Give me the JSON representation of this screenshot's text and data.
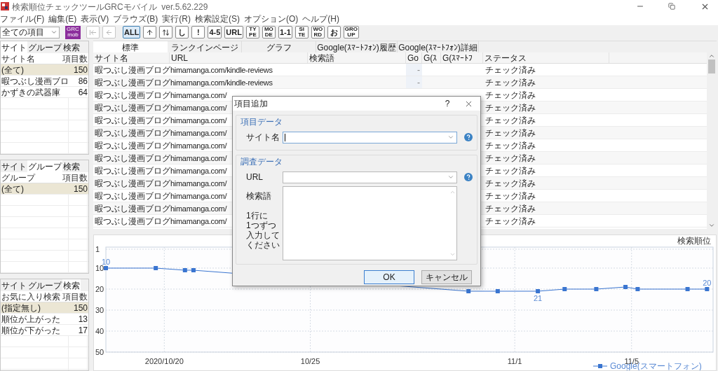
{
  "window": {
    "title": "検索順位チェックツールGRCモバイル  ver.5.62.229"
  },
  "menu": [
    "ファイル(F)",
    "編集(E)",
    "表示(V)",
    "ブラウズ(B)",
    "実行(R)",
    "検索設定(S)",
    "オプション(O)",
    "ヘルプ(H)"
  ],
  "toolbar": {
    "filter": "全ての項目",
    "items": [
      {
        "kind": "logo",
        "lines": [
          "GRC",
          "mob"
        ],
        "selected": false,
        "disabled": false
      },
      {
        "kind": "first",
        "selected": false,
        "disabled": true
      },
      {
        "kind": "back",
        "selected": false,
        "disabled": true
      },
      {
        "kind": "text",
        "lines": [
          "ALL"
        ],
        "selected": true,
        "disabled": false
      },
      {
        "kind": "up",
        "selected": false,
        "disabled": false
      },
      {
        "kind": "updown",
        "selected": false,
        "disabled": false
      },
      {
        "kind": "text",
        "lines": [
          "し"
        ],
        "selected": false,
        "disabled": false
      },
      {
        "kind": "text",
        "lines": [
          "!"
        ],
        "selected": false,
        "disabled": false
      },
      {
        "kind": "text",
        "lines": [
          "4-5"
        ],
        "selected": false,
        "disabled": false
      },
      {
        "kind": "text",
        "lines": [
          "URL"
        ],
        "selected": false,
        "disabled": false
      },
      {
        "kind": "text",
        "lines": [
          "TY",
          "PE"
        ],
        "selected": false,
        "disabled": false
      },
      {
        "kind": "text",
        "lines": [
          "MO",
          "DE"
        ],
        "selected": false,
        "disabled": false
      },
      {
        "kind": "text",
        "lines": [
          "1-1"
        ],
        "selected": false,
        "disabled": false
      },
      {
        "kind": "text",
        "lines": [
          "SI",
          "TE"
        ],
        "selected": false,
        "disabled": false
      },
      {
        "kind": "text",
        "lines": [
          "WO",
          "RD"
        ],
        "selected": false,
        "disabled": false
      },
      {
        "kind": "text",
        "lines": [
          "お"
        ],
        "selected": false,
        "disabled": false
      },
      {
        "kind": "text",
        "lines": [
          "GRO",
          "UP"
        ],
        "selected": false,
        "disabled": false
      }
    ]
  },
  "side_panels": [
    {
      "tabs": [
        {
          "label": "サイト",
          "selected": true
        },
        {
          "label": "グループ",
          "selected": false
        },
        {
          "label": "検索",
          "selected": false
        }
      ],
      "columns": [
        "サイト名",
        "項目数"
      ],
      "rows": [
        {
          "name": "(全て)",
          "count": "150",
          "selected": true
        },
        {
          "name": "暇つぶし漫画ブロ",
          "count": "86",
          "selected": false
        },
        {
          "name": "かずきの武器庫",
          "count": "64",
          "selected": false
        }
      ]
    },
    {
      "tabs": [
        {
          "label": "サイト",
          "selected": false
        },
        {
          "label": "グループ",
          "selected": true
        },
        {
          "label": "検索",
          "selected": false
        }
      ],
      "columns": [
        "グループ",
        "項目数"
      ],
      "rows": [
        {
          "name": "(全て)",
          "count": "150",
          "selected": true
        }
      ]
    },
    {
      "tabs": [
        {
          "label": "サイト",
          "selected": false
        },
        {
          "label": "グループ",
          "selected": false
        },
        {
          "label": "検索",
          "selected": true
        }
      ],
      "columns": [
        "お気に入り検索",
        "項目数"
      ],
      "rows": [
        {
          "name": "(指定無し)",
          "count": "150",
          "selected": true
        },
        {
          "name": "順位が上がった",
          "count": "13",
          "selected": false
        },
        {
          "name": "順位が下がった",
          "count": "17",
          "selected": false
        }
      ]
    }
  ],
  "main_tabs": [
    {
      "label": "標準",
      "selected": true
    },
    {
      "label": "ランクインページ",
      "selected": false
    },
    {
      "label": "グラフ",
      "selected": false
    },
    {
      "label": "Google(ｽﾏｰﾄﾌｫﾝ)履歴",
      "selected": false
    },
    {
      "label": "Google(ｽﾏｰﾄﾌｫﾝ)詳細",
      "selected": false
    }
  ],
  "table": {
    "columns": [
      "サイト名",
      "URL",
      "検索語",
      "Go",
      "G(ｽ",
      "G(ｽﾏｰﾄﾌ",
      "ステータス"
    ],
    "rows": [
      {
        "site": "暇つぶし漫画ブログ",
        "url": "himamanga.com/kindle-reviews",
        "go": "-",
        "status": "チェック済み"
      },
      {
        "site": "暇つぶし漫画ブログ",
        "url": "himamanga.com/kindle-reviews",
        "go": "-",
        "status": "チェック済み"
      },
      {
        "site": "暇つぶし漫画ブログ",
        "url": "himamanga.com/",
        "status": "チェック済み"
      },
      {
        "site": "暇つぶし漫画ブログ",
        "url": "himamanga.com/",
        "status": "チェック済み"
      },
      {
        "site": "暇つぶし漫画ブログ",
        "url": "himamanga.com/",
        "status": "チェック済み"
      },
      {
        "site": "暇つぶし漫画ブログ",
        "url": "himamanga.com/",
        "status": "チェック済み"
      },
      {
        "site": "暇つぶし漫画ブログ",
        "url": "himamanga.com/",
        "status": "チェック済み"
      },
      {
        "site": "暇つぶし漫画ブログ",
        "url": "himamanga.com/",
        "status": "チェック済み"
      },
      {
        "site": "暇つぶし漫画ブログ",
        "url": "himamanga.com/",
        "status": "チェック済み"
      },
      {
        "site": "暇つぶし漫画ブログ",
        "url": "himamanga.com/",
        "status": "チェック済み"
      },
      {
        "site": "暇つぶし漫画ブログ",
        "url": "himamanga.com/",
        "status": "チェック済み"
      },
      {
        "site": "暇つぶし漫画ブログ",
        "url": "himamanga.com/",
        "status": "チェック済み"
      },
      {
        "site": "暇つぶし漫画ブログ",
        "url": "himamanga.com/",
        "status": "チェック済み"
      }
    ]
  },
  "chart": {
    "chart_data": {
      "type": "line",
      "title": "検索順位",
      "x": [
        "2020-10-18",
        "2020-10-19T17:00",
        "2020-10-20T17:00",
        "2020-10-21",
        "2020-10-30T10:00",
        "2020-10-31T10:00",
        "2020-11-01T19:00",
        "2020-11-02T17:00",
        "2020-11-03T19:00",
        "2020-11-04T19:00",
        "2020-11-05T05:00",
        "2020-11-06T22:00",
        "2020-11-07T14:00"
      ],
      "grid": true,
      "series": [
        {
          "name": "Google(スマートフォン)",
          "color": "#3a75d0",
          "marker": "square",
          "values": [
            10,
            10,
            11,
            11,
            21,
            21,
            21,
            20,
            20,
            19,
            20,
            20,
            20
          ]
        }
      ],
      "xlim": [
        "2020-10-18",
        "2020-11-07T19:00"
      ],
      "ylim": [
        50,
        1
      ],
      "xticks": [
        {
          "value": "2020-10-20",
          "label": "2020/10/20"
        },
        {
          "value": "2020-10-25",
          "label": "10/25"
        },
        {
          "value": "2020-11-01",
          "label": "11/1"
        },
        {
          "value": "2020-11-05",
          "label": "11/5"
        }
      ],
      "yticks": [
        1,
        10,
        20,
        30,
        40,
        50
      ],
      "annotations": [
        {
          "x": "2020-10-18",
          "y": 10,
          "text": "10"
        },
        {
          "x": "2020-11-01T19:00",
          "y": 21,
          "text": "21"
        },
        {
          "x": "2020-11-07T14:00",
          "y": 20,
          "text": "20"
        }
      ]
    }
  },
  "dialog": {
    "title": "項目追加",
    "help": "?",
    "groups": [
      {
        "title": "項目データ",
        "fields": [
          {
            "kind": "combo",
            "label": "サイト名",
            "focused": true
          }
        ]
      },
      {
        "title": "調査データ",
        "fields": [
          {
            "kind": "combo",
            "label": "URL",
            "focused": false
          },
          {
            "kind": "textarea",
            "label": "検索語",
            "note_lines": [
              "1行に",
              "1つずつ",
              "入力して",
              "ください"
            ],
            "focused": false
          }
        ]
      }
    ],
    "buttons": [
      {
        "label": "OK",
        "default": true
      },
      {
        "label": "キャンセル",
        "default": false
      }
    ]
  }
}
